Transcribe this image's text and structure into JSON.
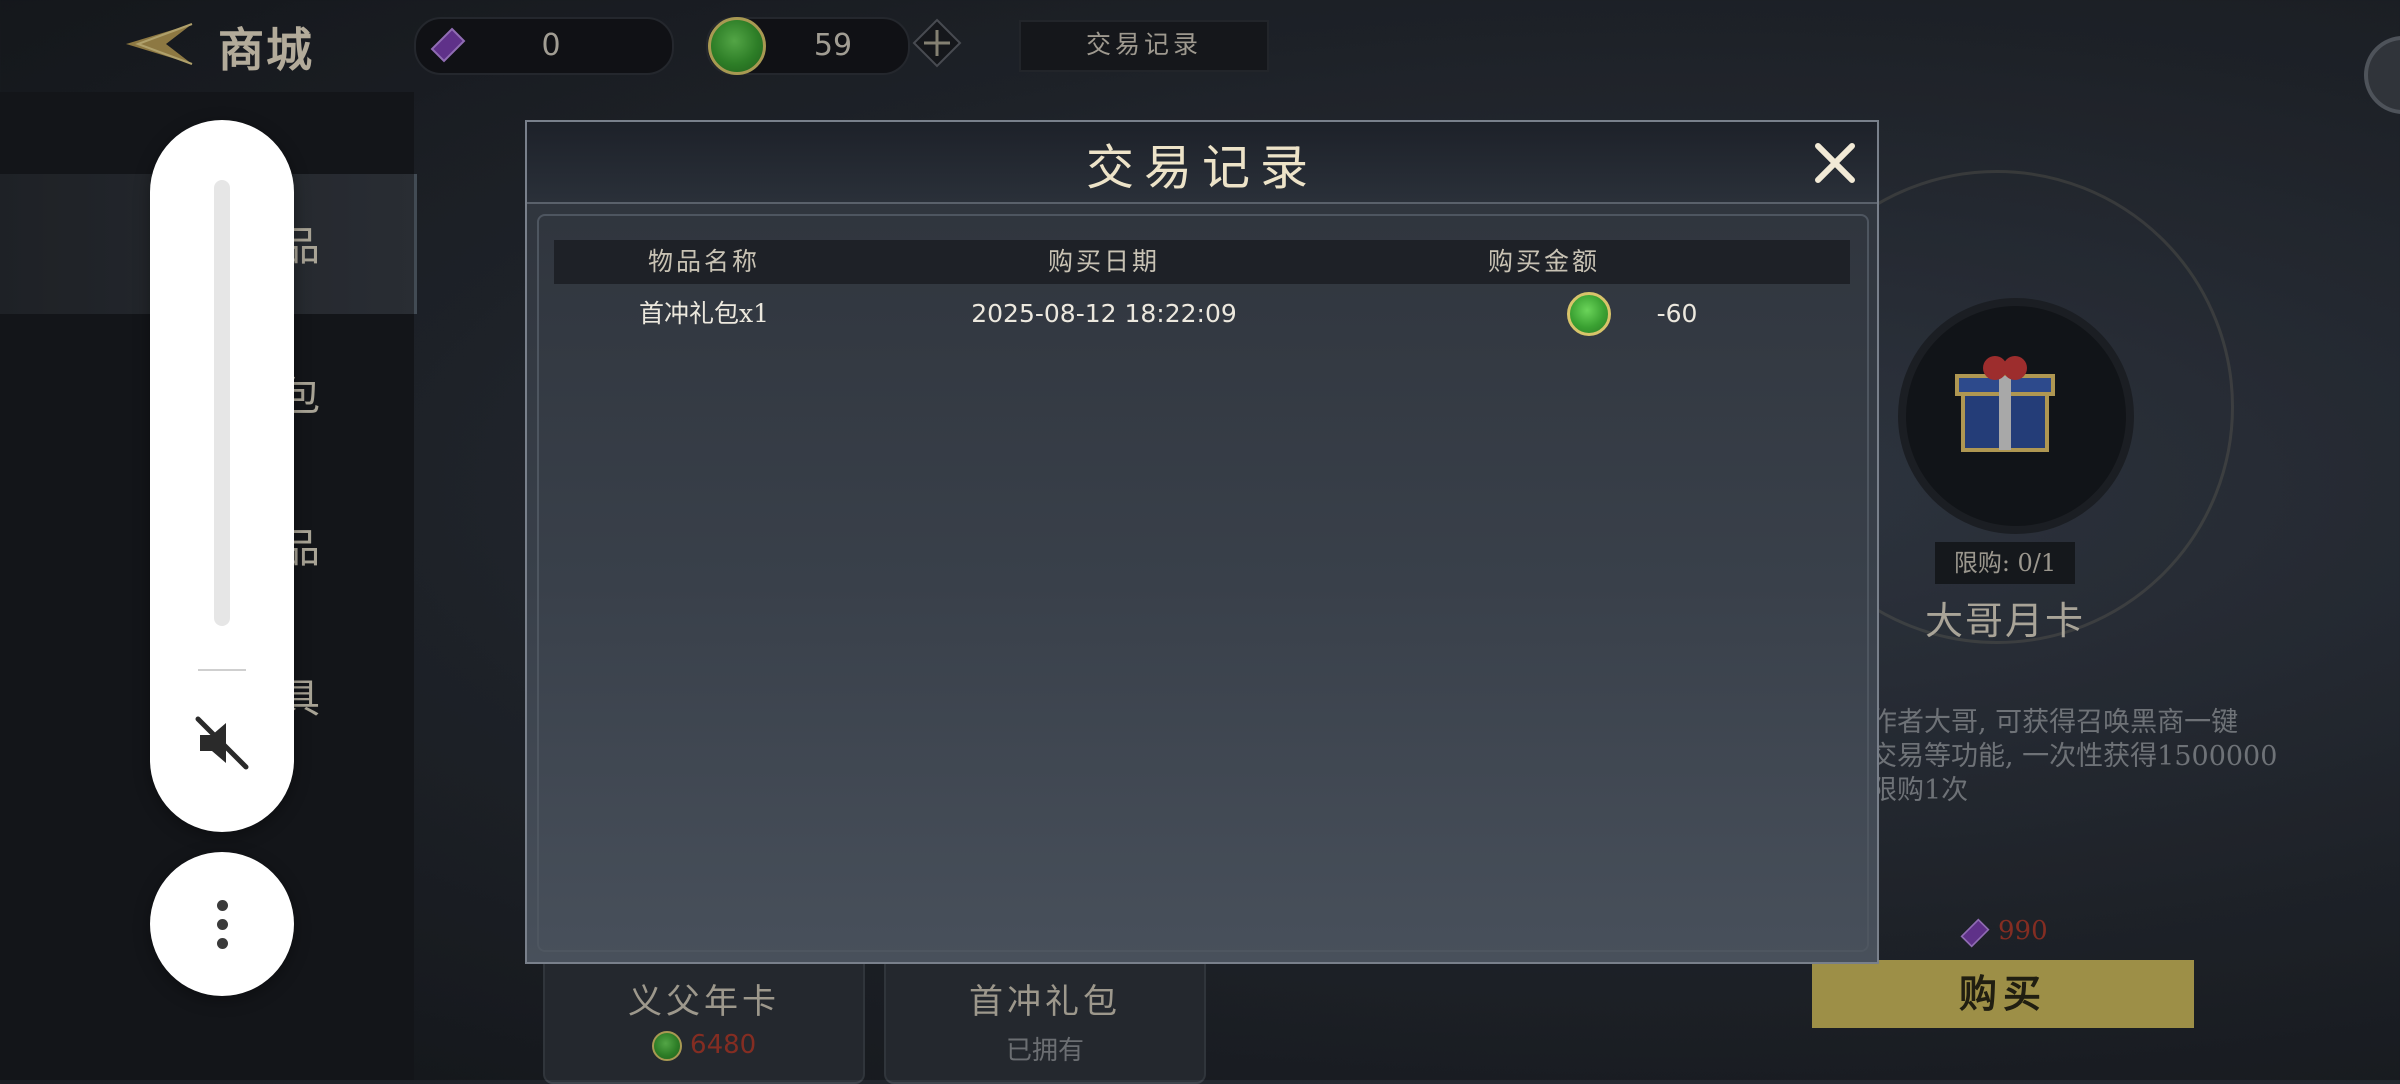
{
  "topbar": {
    "title": "商城",
    "purple_value": "0",
    "green_value": "59",
    "records_label": "交易记录"
  },
  "sidebar": {
    "items": [
      {
        "label": "品"
      },
      {
        "label": "包"
      },
      {
        "label": "品"
      },
      {
        "label": "具"
      }
    ]
  },
  "product": {
    "limit": "限购: 0/1",
    "name": "大哥月卡",
    "desc_lines": [
      "作者大哥, 可获得召唤黑商一键",
      "交易等功能, 一次性获得1500000",
      "限购1次"
    ],
    "price": "990",
    "buy_label": "购买"
  },
  "cards": [
    {
      "title": "义父年卡",
      "sub": "6480"
    },
    {
      "title": "首冲礼包",
      "sub": "已拥有"
    }
  ],
  "modal": {
    "title": "交易记录",
    "columns": [
      "物品名称",
      "购买日期",
      "购买金额"
    ],
    "rows": [
      {
        "name": "首冲礼包x1",
        "date": "2025-08-12 18:22:09",
        "amount": "-60"
      }
    ]
  },
  "colors": {
    "accent_gold": "#c9b85b",
    "price_red": "#a93a2c",
    "coin_green": "#3aa132",
    "gem_purple": "#7a3fb0"
  },
  "icons": [
    "back-arrow-icon",
    "purple-gem-icon",
    "green-coin-icon",
    "plus-icon",
    "close-icon",
    "mute-icon",
    "more-vertical-icon",
    "gift-box-icon"
  ]
}
